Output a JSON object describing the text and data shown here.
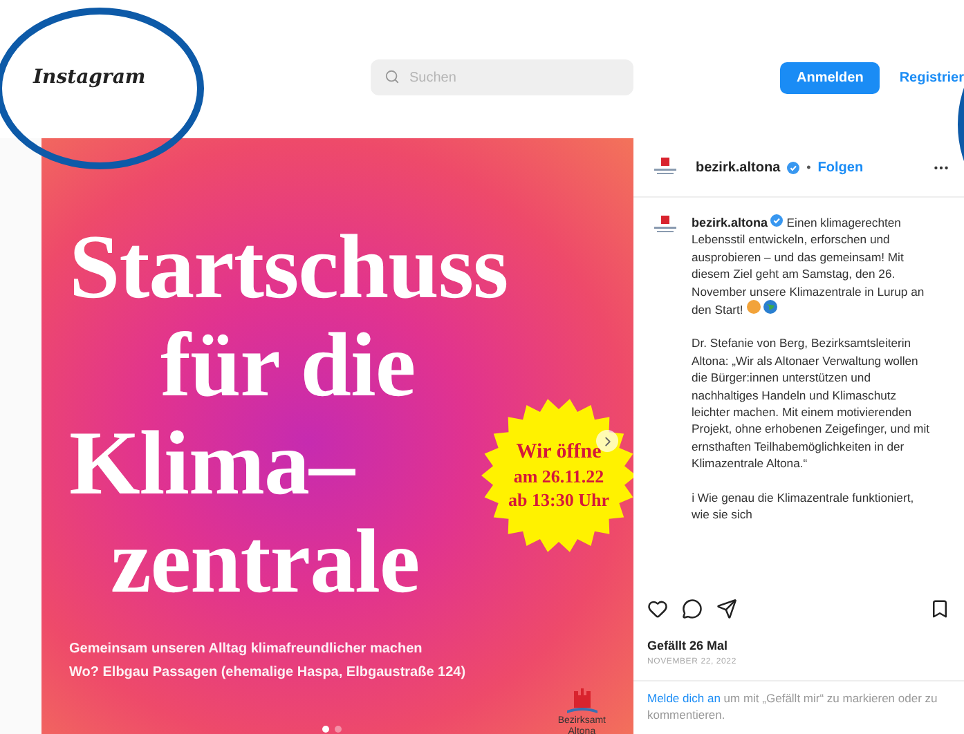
{
  "header": {
    "logo": "Instagram",
    "search": {
      "placeholder": "Suchen"
    },
    "buttons": [
      {
        "label": "Anmelden",
        "kind": "primary"
      },
      {
        "label": "Registrier",
        "kind": "link"
      }
    ]
  },
  "post": {
    "image": {
      "title_lines": [
        "Startschuss",
        "für die",
        "Klima–",
        "zentrale"
      ],
      "badge_lines": [
        "Wir öffne",
        "am 26.11.22",
        "ab 13:30 Uhr"
      ],
      "subtitle_lines": [
        "Gemeinsam unseren Alltag klimafreundlicher machen",
        "Wo? Elbgau Passagen (ehemalige Haspa, Elbgaustraße 124)"
      ],
      "logo_lines": [
        "Bezirksamt",
        "Altona"
      ],
      "slides": [
        {
          "selected": true
        },
        {
          "selected": false
        }
      ]
    },
    "author": {
      "username": "bezirk.altona",
      "separator": "•",
      "follow": "Folgen"
    },
    "caption": {
      "username": "bezirk.altona",
      "paragraphs": [
        "Einen klimagerechten Lebensstil entwickeln, erforschen und ausprobieren – und das gemeinsam! Mit diesem Ziel geht am Samstag, den 26. November unsere Klimazentrale in Lurup an den Start!",
        "Dr. Stefanie von Berg, Bezirksamtsleiterin Altona: „Wir als Altonaer Verwaltung wollen die Bürger:innen unterstützen und nachhaltiges Handeln und Klimaschutz leichter machen. Mit einem motivierenden Projekt, ohne erhobenen Zeigefinger, und mit ernsthaften Teilhabemöglichkeiten in der Klimazentrale Altona.“",
        "ℹ Wie genau die Klimazentrale funktioniert, wie sie sich"
      ]
    },
    "likes": "Gefällt 26 Mal",
    "date": "NOVEMBER 22, 2022",
    "login_prompt": {
      "link": "Melde dich an",
      "text": "um mit „Gefällt mir“ zu markieren oder zu kommentieren."
    }
  }
}
